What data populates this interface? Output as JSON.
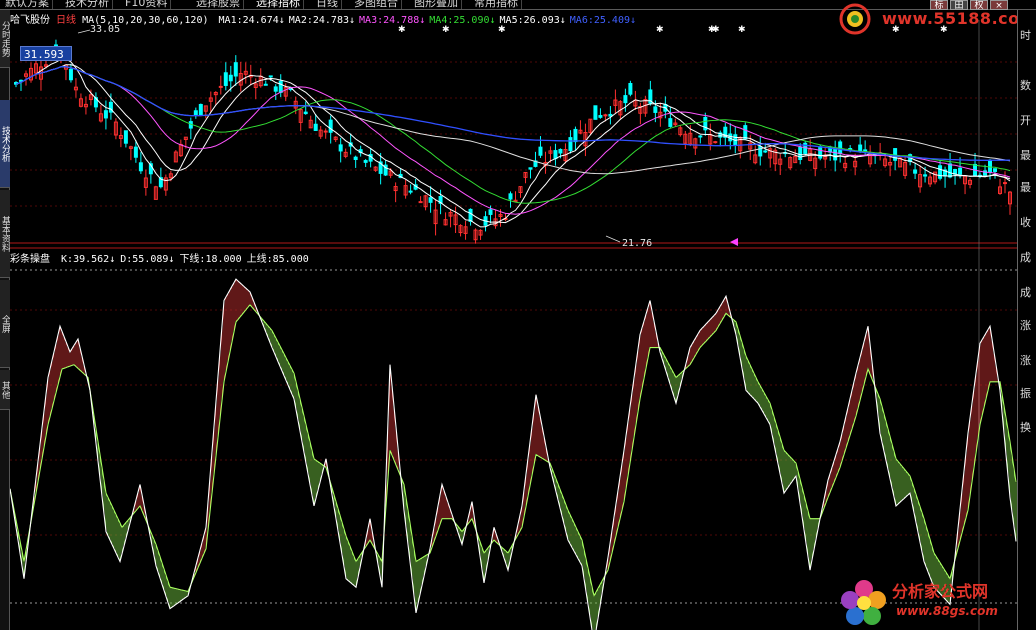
{
  "menu": [
    "默认方案",
    "技术分析",
    "F10资料",
    "选择股票",
    "选择指标",
    "日线",
    "多图组合",
    "图形叠加",
    "常用指标"
  ],
  "menu_active": 4,
  "topright": {
    "buttons": [
      "标",
      "田",
      "权",
      "×"
    ]
  },
  "watermark_top": {
    "url": "www.55188.com"
  },
  "watermark_bottom": {
    "name": "分析家公式网",
    "url": "www.88gs.com"
  },
  "left_tabs": [
    "分时走势",
    "技术分析",
    "基本资料",
    "全屏",
    "其他"
  ],
  "left_tab_active": 1,
  "right_labels": [
    "时",
    "数",
    "开",
    "最",
    "最",
    "收",
    "成",
    "成",
    "涨",
    "涨",
    "振",
    "换"
  ],
  "stock": {
    "name": "哈飞股份",
    "period": "日线",
    "last_price": "31.593"
  },
  "ma_legend": {
    "ma_params": "MA(5,10,20,30,60,120)",
    "items": [
      {
        "label": "MA1:",
        "value": "24.674",
        "color": "#ffffff"
      },
      {
        "label": "MA2:",
        "value": "24.783",
        "color": "#ffffff"
      },
      {
        "label": "MA3:",
        "value": "24.788",
        "color": "#ff55ff"
      },
      {
        "label": "MA4:",
        "value": "25.090",
        "color": "#33dd33"
      },
      {
        "label": "MA5:",
        "value": "26.093",
        "color": "#ffffff"
      },
      {
        "label": "MA6:",
        "value": "25.409",
        "color": "#4060ff"
      }
    ]
  },
  "price_marks": {
    "high": "33.05",
    "low": "21.76"
  },
  "indicator_legend": {
    "name": "彩条操盘",
    "items": [
      {
        "label": "K:",
        "value": "39.562"
      },
      {
        "label": "D:",
        "value": "55.089"
      },
      {
        "label": "下线:",
        "value": "18.000"
      },
      {
        "label": "上线:",
        "value": "85.000"
      }
    ]
  },
  "colors": {
    "up": "#ff3030",
    "down": "#00ffff",
    "k_line": "#ffffff",
    "d_line": "#a8ff60",
    "grid": "#a01010"
  },
  "chart_data": [
    {
      "type": "candlestick",
      "title": "哈飞股份 日线",
      "ylim": [
        21.0,
        33.6
      ],
      "high_label": 33.05,
      "low_label": 21.76,
      "x_count": 200
    },
    {
      "type": "line",
      "title": "彩条操盘",
      "ylim": [
        14,
        100
      ],
      "series": [
        {
          "name": "K"
        },
        {
          "name": "D"
        }
      ],
      "lower_line": 18,
      "upper_line": 85
    }
  ]
}
